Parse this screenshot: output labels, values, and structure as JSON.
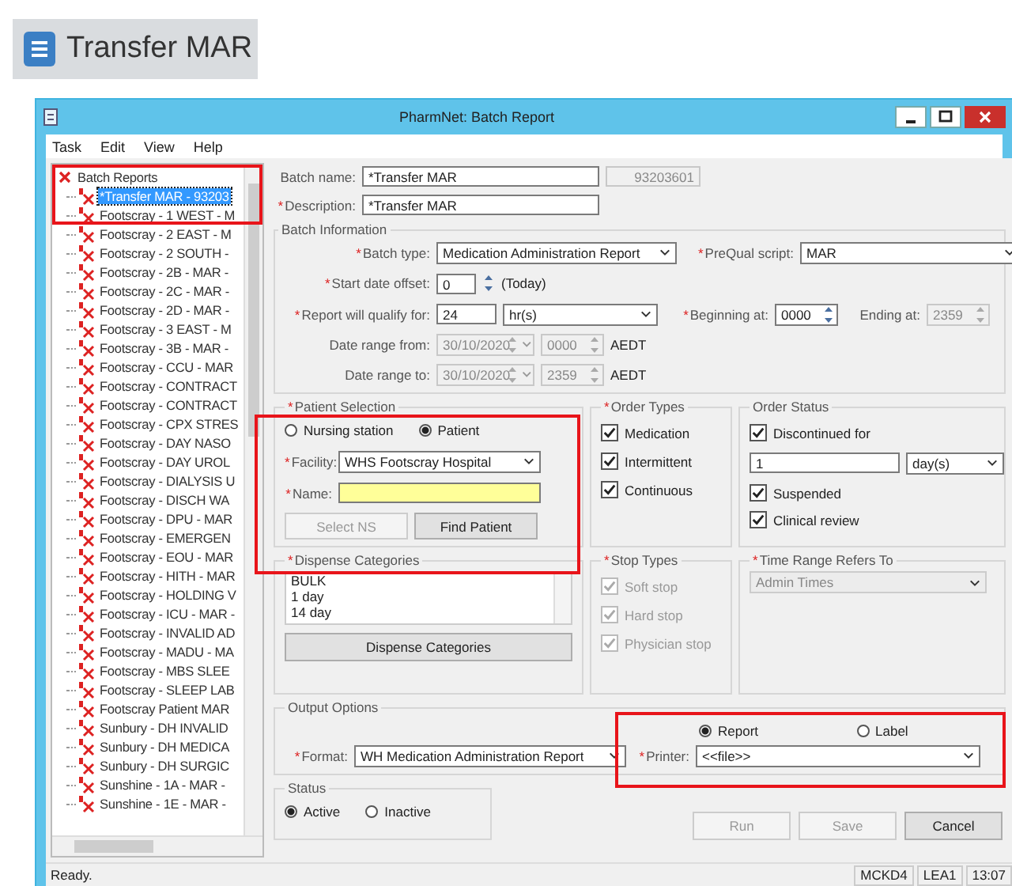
{
  "banner": {
    "title": "Transfer MAR"
  },
  "window": {
    "title": "PharmNet: Batch Report"
  },
  "menu": [
    {
      "label": "Task"
    },
    {
      "label": "Edit"
    },
    {
      "label": "View"
    },
    {
      "label": "Help"
    }
  ],
  "tree": {
    "label": "Batch Reports",
    "items": [
      {
        "label": "*Transfer MAR - 93203",
        "selected": true
      },
      {
        "label": "Footscray - 1 WEST - M",
        "selected": false
      },
      {
        "label": "Footscray - 2 EAST - M",
        "selected": false
      },
      {
        "label": "Footscray - 2 SOUTH -",
        "selected": false
      },
      {
        "label": "Footscray - 2B - MAR -",
        "selected": false
      },
      {
        "label": "Footscray - 2C - MAR -",
        "selected": false
      },
      {
        "label": "Footscray - 2D - MAR -",
        "selected": false
      },
      {
        "label": "Footscray - 3 EAST - M",
        "selected": false
      },
      {
        "label": "Footscray - 3B - MAR -",
        "selected": false
      },
      {
        "label": "Footscray - CCU - MAR",
        "selected": false
      },
      {
        "label": "Footscray - CONTRACT",
        "selected": false
      },
      {
        "label": "Footscray - CONTRACT",
        "selected": false
      },
      {
        "label": "Footscray - CPX STRES",
        "selected": false
      },
      {
        "label": "Footscray - DAY NASO",
        "selected": false
      },
      {
        "label": "Footscray - DAY UROL",
        "selected": false
      },
      {
        "label": "Footscray - DIALYSIS U",
        "selected": false
      },
      {
        "label": "Footscray - DISCH WA",
        "selected": false
      },
      {
        "label": "Footscray - DPU - MAR",
        "selected": false
      },
      {
        "label": "Footscray - EMERGEN",
        "selected": false
      },
      {
        "label": "Footscray - EOU - MAR",
        "selected": false
      },
      {
        "label": "Footscray - HITH - MAR",
        "selected": false
      },
      {
        "label": "Footscray - HOLDING V",
        "selected": false
      },
      {
        "label": "Footscray - ICU - MAR -",
        "selected": false
      },
      {
        "label": "Footscray - INVALID AD",
        "selected": false
      },
      {
        "label": "Footscray - MADU - MA",
        "selected": false
      },
      {
        "label": "Footscray - MBS SLEE",
        "selected": false
      },
      {
        "label": "Footscray - SLEEP LAB",
        "selected": false
      },
      {
        "label": "Footscray Patient MAR",
        "selected": false
      },
      {
        "label": "Sunbury - DH INVALID",
        "selected": false
      },
      {
        "label": "Sunbury - DH MEDICA",
        "selected": false
      },
      {
        "label": "Sunbury - DH SURGIC",
        "selected": false
      },
      {
        "label": "Sunshine - 1A - MAR -",
        "selected": false
      },
      {
        "label": "Sunshine - 1E - MAR -",
        "selected": false
      }
    ]
  },
  "batch_name": {
    "label": "Batch name:",
    "value": "*Transfer MAR",
    "id": "93203601"
  },
  "description": {
    "mark": "*",
    "label": "Description:",
    "value": "*Transfer MAR"
  },
  "batch_information": {
    "title": "Batch Information",
    "batch_type": {
      "mark": "*",
      "label": "Batch type:",
      "value": "Medication Administration Report"
    },
    "prequal_script": {
      "mark": "*",
      "label": "PreQual script:",
      "value": "MAR"
    },
    "start_date_offset": {
      "mark": "*",
      "label": "Start date offset:",
      "value": "0",
      "note": "(Today)"
    },
    "qualify_for": {
      "mark": "*",
      "label": "Report will qualify for:",
      "value": "24",
      "unit": "hr(s)"
    },
    "beginning_at": {
      "mark": "*",
      "label": "Beginning at:",
      "value": "0000"
    },
    "ending_at": {
      "label": "Ending at:",
      "value": "2359",
      "disabled": true
    },
    "date_range_from": {
      "label": "Date range from:",
      "date": "30/10/2020",
      "time": "0000",
      "zone": "AEDT",
      "disabled": true
    },
    "date_range_to": {
      "label": "Date range to:",
      "date": "30/10/2020",
      "time": "2359",
      "zone": "AEDT",
      "disabled": true
    }
  },
  "patient_selection": {
    "mark": "*",
    "title": "Patient Selection",
    "modes": [
      {
        "label": "Nursing station",
        "selected": false
      },
      {
        "label": "Patient",
        "selected": true
      }
    ],
    "facility": {
      "mark": "*",
      "label": "Facility:",
      "value": "WHS Footscray Hospital"
    },
    "name": {
      "mark": "*",
      "label": "Name:"
    },
    "buttons": [
      {
        "label": "Select NS",
        "disabled": true
      },
      {
        "label": "Find Patient",
        "disabled": false
      }
    ]
  },
  "order_types": {
    "mark": "*",
    "title": "Order Types",
    "items": [
      {
        "label": "Medication",
        "checked": true,
        "disabled": false
      },
      {
        "label": "Intermittent",
        "checked": true,
        "disabled": false
      },
      {
        "label": "Continuous",
        "checked": true,
        "disabled": false
      }
    ]
  },
  "order_status": {
    "title": "Order Status",
    "discontinued": {
      "label": "Discontinued for",
      "checked": true,
      "value": "1",
      "unit": "day(s)"
    },
    "items": [
      {
        "label": "Suspended",
        "checked": true,
        "disabled": false
      },
      {
        "label": "Clinical review",
        "checked": true,
        "disabled": false
      }
    ]
  },
  "dispense_categories": {
    "mark": "*",
    "title": "Dispense Categories",
    "items": [
      "BULK",
      "1 day",
      "14 day"
    ],
    "button": "Dispense Categories"
  },
  "stop_types": {
    "mark": "*",
    "title": "Stop Types",
    "items": [
      {
        "label": "Soft stop",
        "checked": true,
        "disabled": true
      },
      {
        "label": "Hard stop",
        "checked": true,
        "disabled": true
      },
      {
        "label": "Physician stop",
        "checked": true,
        "disabled": true
      }
    ]
  },
  "time_range": {
    "mark": "*",
    "title": "Time Range Refers To",
    "value": "Admin Times",
    "disabled": true
  },
  "output_options": {
    "title": "Output Options",
    "modes": [
      {
        "label": "Report",
        "selected": true
      },
      {
        "label": "Label",
        "selected": false
      }
    ],
    "format": {
      "mark": "*",
      "label": "Format:",
      "value": "WH Medication Administration Report"
    },
    "printer": {
      "mark": "*",
      "label": "Printer:",
      "value": "<<file>>"
    }
  },
  "status": {
    "title": "Status",
    "options": [
      {
        "label": "Active",
        "selected": true
      },
      {
        "label": "Inactive",
        "selected": false
      }
    ]
  },
  "buttons": [
    {
      "label": "Run",
      "disabled": true
    },
    {
      "label": "Save",
      "disabled": true
    },
    {
      "label": "Cancel",
      "disabled": false
    }
  ],
  "status_bar": {
    "message": "Ready.",
    "panels": [
      "MCKD4",
      "LEA1",
      "13:07"
    ]
  }
}
